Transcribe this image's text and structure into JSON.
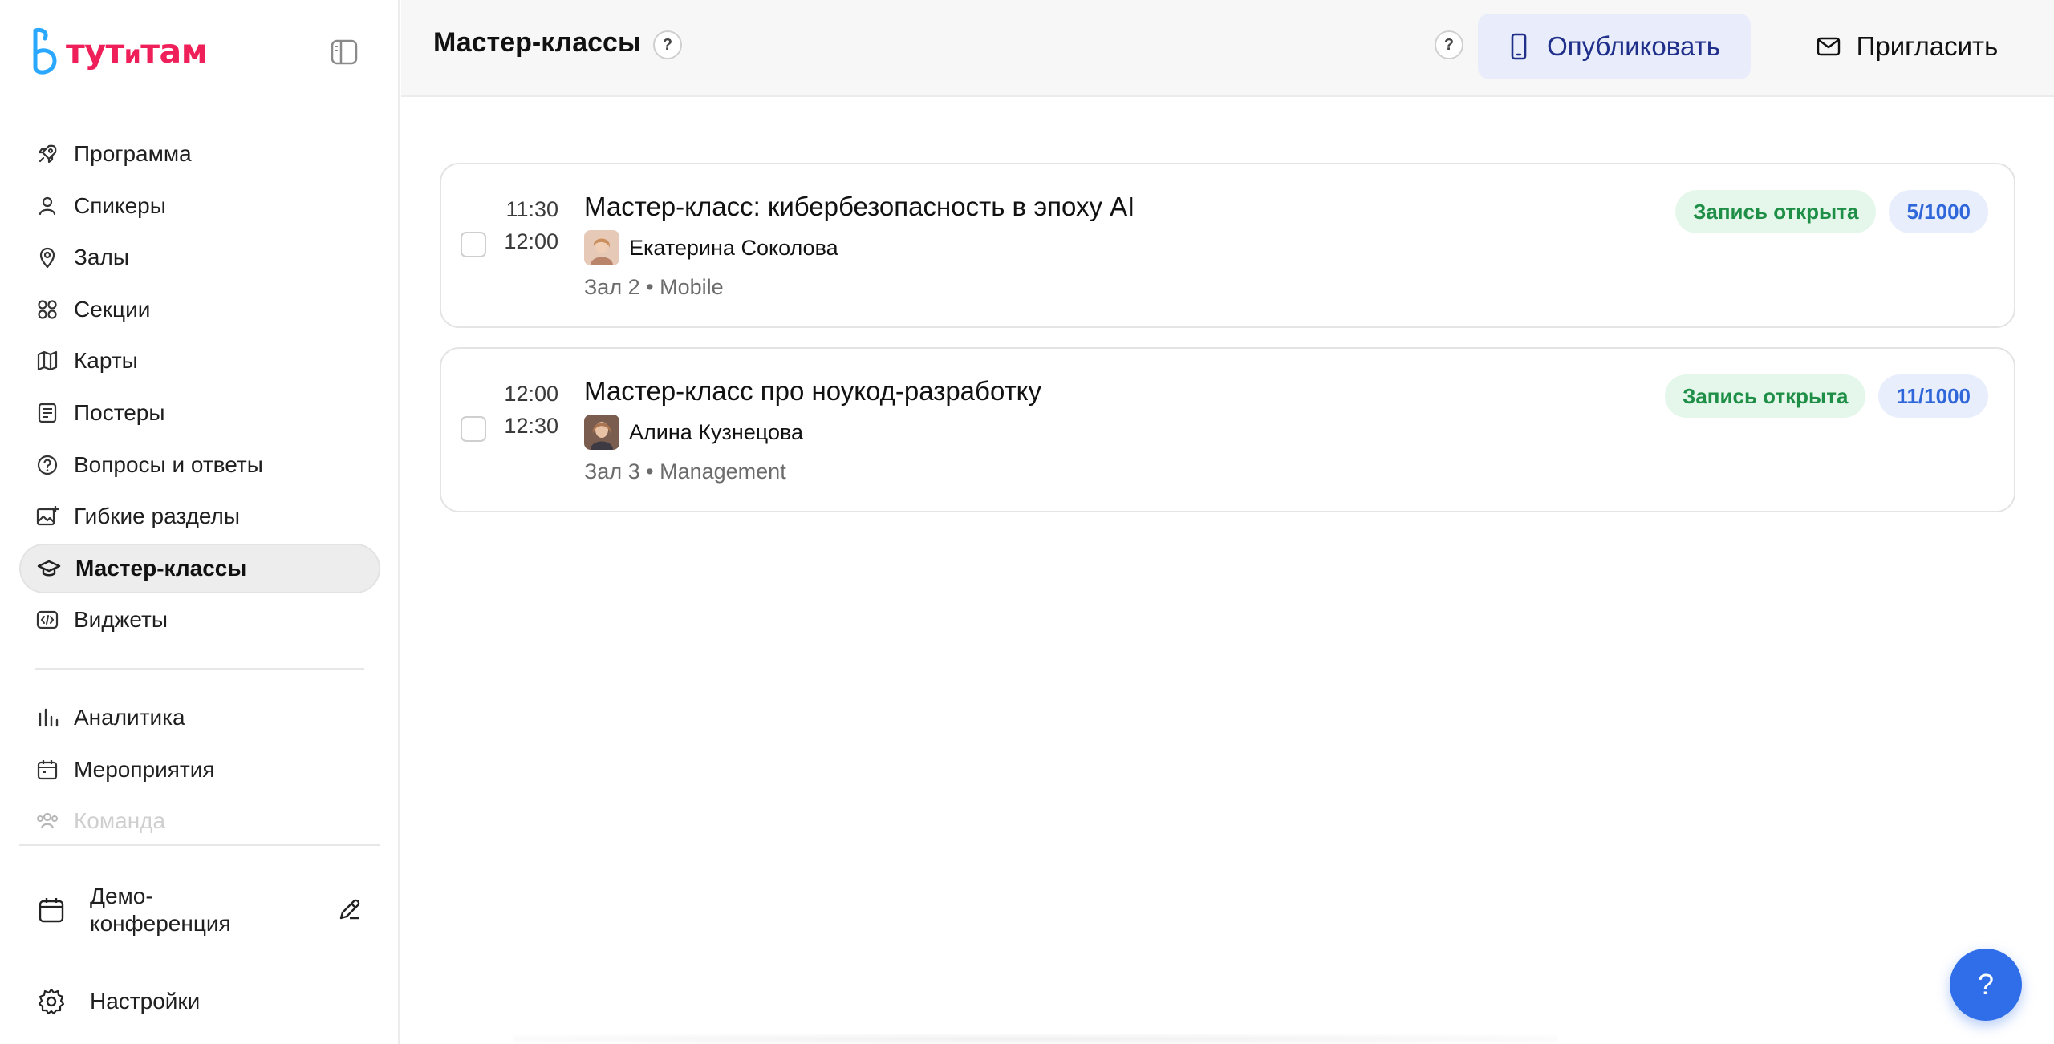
{
  "brand": {
    "name_part1": "тут",
    "name_part2": "и",
    "name_part3": "там",
    "color": "#ef1f5a"
  },
  "sidebar": {
    "items": [
      {
        "label": "Программа",
        "icon": "rocket-icon"
      },
      {
        "label": "Спикеры",
        "icon": "user-icon"
      },
      {
        "label": "Залы",
        "icon": "map-pin-icon"
      },
      {
        "label": "Секции",
        "icon": "grid-circles-icon"
      },
      {
        "label": "Карты",
        "icon": "map-icon"
      },
      {
        "label": "Постеры",
        "icon": "poster-icon"
      },
      {
        "label": "Вопросы и ответы",
        "icon": "question-circle-icon"
      },
      {
        "label": "Гибкие разделы",
        "icon": "image-plus-icon"
      },
      {
        "label": "Мастер-классы",
        "icon": "graduation-cap-icon",
        "active": true
      },
      {
        "label": "Виджеты",
        "icon": "code-icon"
      }
    ],
    "items2": [
      {
        "label": "Аналитика",
        "icon": "bar-chart-icon"
      },
      {
        "label": "Мероприятия",
        "icon": "calendar-icon"
      },
      {
        "label": "Команда",
        "icon": "team-icon"
      }
    ],
    "event_name": "Демо-конференция",
    "settings_label": "Настройки"
  },
  "header": {
    "title": "Мастер-классы",
    "help_glyph": "?",
    "publish_label": "Опубликовать",
    "invite_label": "Пригласить"
  },
  "classes": [
    {
      "start": "11:30",
      "end": "12:00",
      "title": "Мастер-класс: кибербезопасность в эпоху AI",
      "speaker": "Екатерина Соколова",
      "hall": "Зал 2",
      "section": "Mobile",
      "status": "Запись открыта",
      "count": "5/1000"
    },
    {
      "start": "12:00",
      "end": "12:30",
      "title": "Мастер-класс про ноукод-разработку",
      "speaker": "Алина Кузнецова",
      "hall": "Зал 3",
      "section": "Management",
      "status": "Запись открыта",
      "count": "11/1000"
    }
  ],
  "meta_separator": "•",
  "fab_glyph": "?",
  "colors": {
    "accent": "#2f6ee8",
    "status_green": "#1f8f47",
    "count_blue": "#2f66d9"
  }
}
